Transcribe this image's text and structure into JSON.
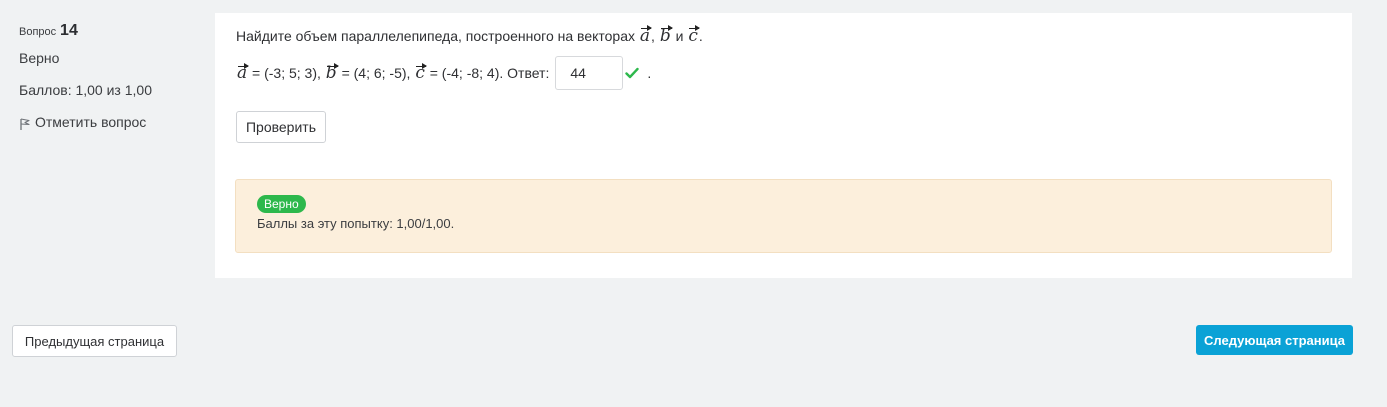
{
  "question_info": {
    "label": "Вопрос",
    "number": "14",
    "state": "Верно",
    "grade": "Баллов: 1,00 из 1,00",
    "flag_label": "Отметить вопрос"
  },
  "question": {
    "text": "Найдите объем параллелепипеда, построенного на векторах",
    "vectors": [
      "a",
      "b",
      "c"
    ],
    "comma": ",",
    "and": "и",
    "period": ".",
    "formula": {
      "a_value": "= (-3; 5; 3),",
      "b_value": "= (4; 6; -5),",
      "c_value": "= (-4; -8; 4). Ответ:"
    },
    "answer_value": "44",
    "answer_period": ".",
    "check_button": "Проверить"
  },
  "feedback": {
    "badge": "Верно",
    "marks_text": "Баллы за эту попытку: 1,00/1,00."
  },
  "navigation": {
    "prev": "Предыдущая страница",
    "next": "Следующая страница"
  },
  "colors": {
    "correct": "#2db84c",
    "primary": "#0aa2d6",
    "feedback_bg": "#fcefdc",
    "page_bg": "#f0f2f3"
  }
}
